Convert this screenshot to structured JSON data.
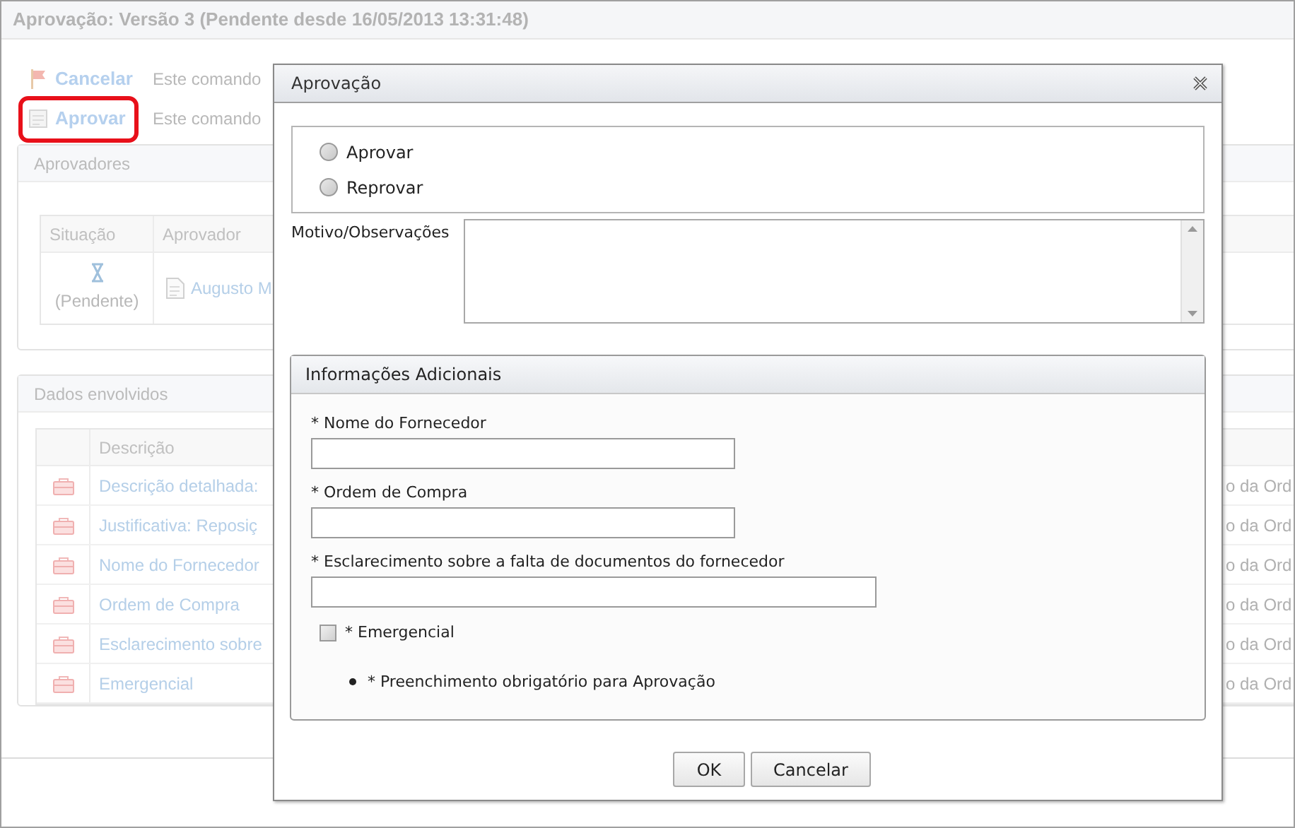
{
  "page_title": "Aprovação: Versão 3 (Pendente desde 16/05/2013 13:31:48)",
  "commands": [
    {
      "kind": "flag",
      "label": "Cancelar",
      "description": "Este comando",
      "highlighted": false
    },
    {
      "kind": "sheet",
      "label": "Aprovar",
      "description": "Este comando",
      "highlighted": true
    }
  ],
  "approvers_panel": {
    "title": "Aprovadores",
    "columns": [
      "Situação",
      "Aprovador"
    ],
    "rows": [
      {
        "status": "(Pendente)",
        "approver": "Augusto M"
      }
    ]
  },
  "data_panel": {
    "title": "Dados envolvidos",
    "columns": [
      "Descrição"
    ],
    "rows": [
      {
        "description": "Descrição detalhada:",
        "column_3": "o da Ord"
      },
      {
        "description": "Justificativa: Reposiç",
        "column_3": "o da Ord"
      },
      {
        "description": "Nome do Fornecedor",
        "column_3": "o da Ord"
      },
      {
        "description": "Ordem de Compra",
        "column_3": "o da Ord"
      },
      {
        "description": "Esclarecimento sobre",
        "column_3": "o da Ord"
      },
      {
        "description": "Emergencial",
        "column_3": "o da Ord"
      }
    ]
  },
  "dialog": {
    "title": "Aprovação",
    "options": [
      {
        "label": "Aprovar",
        "selected": false
      },
      {
        "label": "Reprovar",
        "selected": false
      }
    ],
    "notes_label": "Motivo/Observações",
    "additional": {
      "title": "Informações Adicionais",
      "fields": [
        {
          "label": "* Nome do Fornecedor",
          "kind": "short"
        },
        {
          "label": "* Ordem de Compra",
          "kind": "short"
        },
        {
          "label": "* Esclarecimento sobre a falta de documentos do fornecedor",
          "kind": "long"
        }
      ],
      "checkbox": {
        "label": "* Emergencial",
        "checked": false
      },
      "notes": [
        "* Preenchimento obrigatório para Aprovação"
      ]
    },
    "buttons": [
      "OK",
      "Cancelar"
    ]
  }
}
